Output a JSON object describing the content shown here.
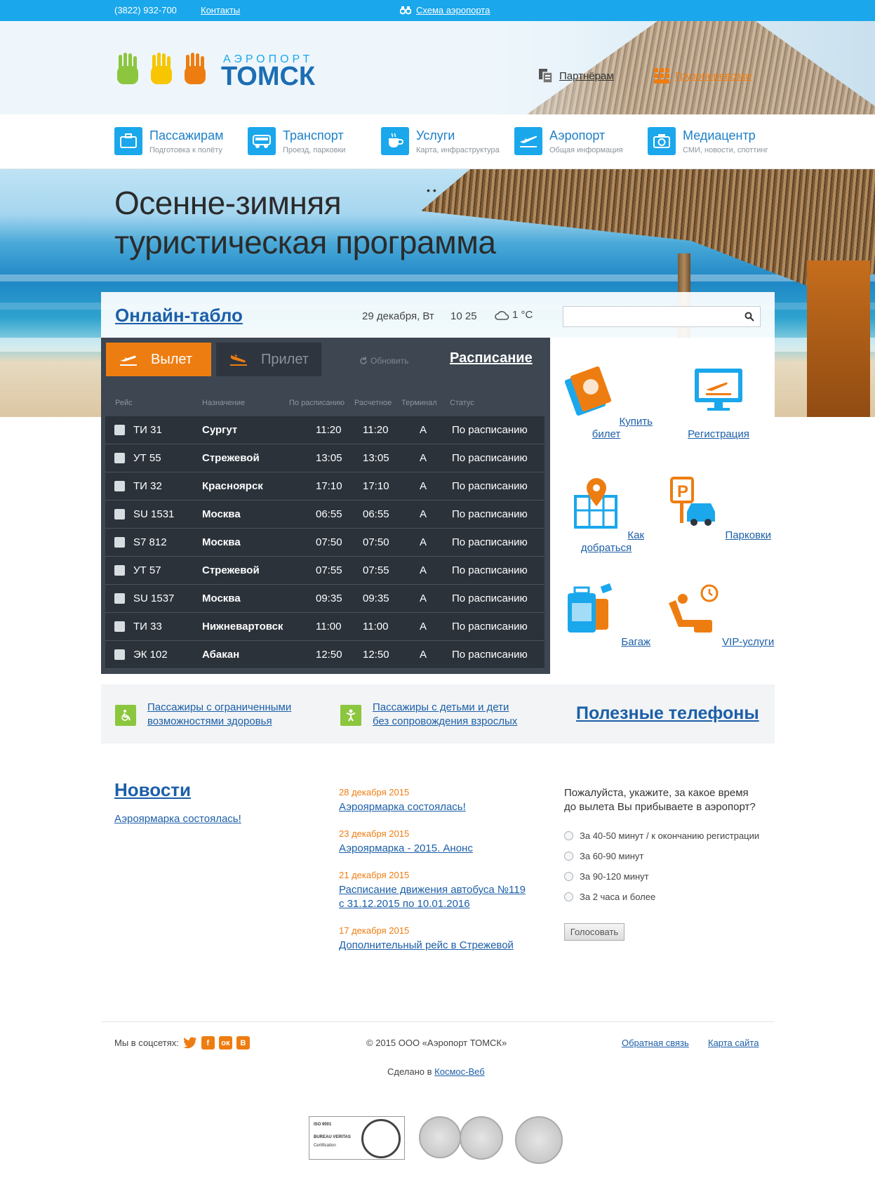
{
  "topbar": {
    "phone": "(3822) 932-700",
    "contacts": "Контакты",
    "scheme": "Схема аэропорта"
  },
  "logo": {
    "small": "АЭРОПОРТ",
    "big": "ТОМСК"
  },
  "header_links": {
    "partners": "Партнёрам",
    "cargo": "Грузоперевозки"
  },
  "nav": [
    {
      "title": "Пассажирам",
      "sub": "Подготовка к полёту"
    },
    {
      "title": "Транспорт",
      "sub": "Проезд, парковки"
    },
    {
      "title": "Услуги",
      "sub": "Карта, инфраструктура"
    },
    {
      "title": "Аэропорт",
      "sub": "Общая информация"
    },
    {
      "title": "Медиацентр",
      "sub": "СМИ, новости, споттинг"
    }
  ],
  "hero": {
    "line1": "Осенне-зимняя",
    "line2": "туристическая программа"
  },
  "tablo": {
    "title": "Онлайн-табло",
    "date": "29 декабря, Вт",
    "time": "10 25",
    "temp": "1 °C"
  },
  "board": {
    "tab_departure": "Вылет",
    "tab_arrival": "Прилет",
    "refresh": "Обновить",
    "schedule": "Расписание",
    "columns": [
      "Рейс",
      "Назначение",
      "По расписанию",
      "Расчетное",
      "Терминал",
      "Статус"
    ],
    "rows": [
      {
        "flight": "ТИ 31",
        "dest": "Сургут",
        "sched": "11:20",
        "est": "11:20",
        "term": "A",
        "status": "По расписанию"
      },
      {
        "flight": "УТ 55",
        "dest": "Стрежевой",
        "sched": "13:05",
        "est": "13:05",
        "term": "A",
        "status": "По расписанию"
      },
      {
        "flight": "ТИ 32",
        "dest": "Красноярск",
        "sched": "17:10",
        "est": "17:10",
        "term": "A",
        "status": "По расписанию"
      },
      {
        "flight": "SU 1531",
        "dest": "Москва",
        "sched": "06:55",
        "est": "06:55",
        "term": "A",
        "status": "По расписанию"
      },
      {
        "flight": "S7 812",
        "dest": "Москва",
        "sched": "07:50",
        "est": "07:50",
        "term": "A",
        "status": "По расписанию"
      },
      {
        "flight": "УТ 57",
        "dest": "Стрежевой",
        "sched": "07:55",
        "est": "07:55",
        "term": "A",
        "status": "По расписанию"
      },
      {
        "flight": "SU 1537",
        "dest": "Москва",
        "sched": "09:35",
        "est": "09:35",
        "term": "A",
        "status": "По расписанию"
      },
      {
        "flight": "ТИ 33",
        "dest": "Нижневартовск",
        "sched": "11:00",
        "est": "11:00",
        "term": "A",
        "status": "По расписанию"
      },
      {
        "flight": "ЭК 102",
        "dest": "Абакан",
        "sched": "12:50",
        "est": "12:50",
        "term": "A",
        "status": "По расписанию"
      }
    ]
  },
  "services": [
    "Купить билет",
    "Регистрация",
    "Как добраться",
    "Парковки",
    "Багаж",
    "VIP-услуги"
  ],
  "special": {
    "disabled_1": "Пассажиры с ограниченными",
    "disabled_2": "возможностями здоровья",
    "kids_1": "Пассажиры с детьми и дети",
    "kids_2": "без сопровождения взрослых",
    "phones": "Полезные телефоны"
  },
  "news": {
    "title": "Новости",
    "featured": " Аэроярмарка состоялась!",
    "items": [
      {
        "date": "28 декабря 2015",
        "title": "Аэроярмарка состоялась!"
      },
      {
        "date": "23 декабря 2015",
        "title": "Аэроярмарка - 2015. Анонс"
      },
      {
        "date": "21 декабря 2015",
        "title_1": "Расписание движения автобуса №119",
        "title_2": "с 31.12.2015 по 10.01.2016"
      },
      {
        "date": "17 декабря 2015",
        "title": "Дополнительный рейс в Стрежевой"
      }
    ]
  },
  "poll": {
    "question_1": "Пожалуйста, укажите, за какое время",
    "question_2": "до вылета Вы прибываете в аэропорт?",
    "options": [
      "За 40-50 минут / к окончанию регистрации",
      "За 60-90 минут",
      "За 90-120 минут",
      "За 2 часа и более"
    ],
    "button": "Голосовать"
  },
  "footer": {
    "social_label": "Мы в соцсетях:",
    "copyright": "© 2015 ООО «Аэропорт ТОМСК»",
    "feedback": "Обратная связь",
    "sitemap": "Карта сайта",
    "made_prefix": "Сделано в ",
    "made_link": "Космос-Веб",
    "cert_1": "ISO 9001",
    "cert_2": "BUREAU VERITAS",
    "cert_3": "Certification"
  },
  "colors": {
    "accent_blue": "#1aa7ec",
    "accent_orange": "#ee7d11",
    "link": "#1c5fa8",
    "board_bg": "#3d4651"
  }
}
